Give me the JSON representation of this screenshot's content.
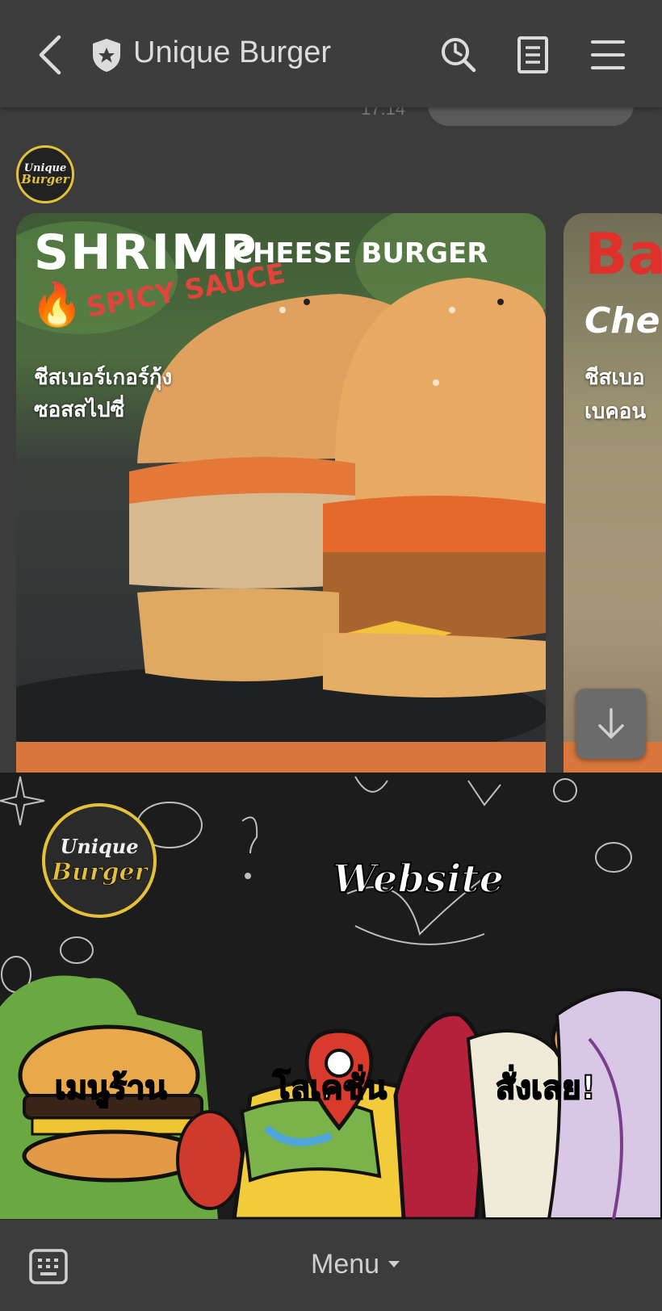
{
  "header": {
    "back_icon": "chevron-left-icon",
    "shield_icon": "shield-star-icon",
    "title": "Unique Burger",
    "search_icon": "search-clock-icon",
    "notes_icon": "notes-icon",
    "menu_icon": "hamburger-menu-icon"
  },
  "chat": {
    "timestamp": "17:14",
    "avatar": {
      "line1": "Unique",
      "line2": "Burger"
    },
    "cards": [
      {
        "heading_main": "SHRIMP",
        "heading_sub": "CHEESE BURGER",
        "tag": "SPICY SAUCE",
        "thai_line1": "ชีสเบอร์เกอร์กุ้ง",
        "thai_line2": "ซอสสไปซี่"
      },
      {
        "heading_main": "Ba",
        "heading_sub": "Che",
        "thai_line1": "ชีสเบอ",
        "thai_line2": "เบคอน"
      }
    ],
    "scroll_down_icon": "arrow-down-icon"
  },
  "rich_menu": {
    "logo_line1": "Unique",
    "logo_line2": "Burger",
    "website_label": "Website",
    "items": [
      {
        "label": "เมนูร้าน"
      },
      {
        "label": "โลเคชั่น"
      },
      {
        "label": "สั่งเลย!"
      }
    ]
  },
  "bottom_bar": {
    "keyboard_icon": "keyboard-icon",
    "menu_label": "Menu",
    "caret_icon": "caret-down-icon"
  },
  "colors": {
    "header_bg": "#3d3d3d",
    "accent_orange": "#d8763b",
    "brand_yellow": "#e5c13a"
  }
}
